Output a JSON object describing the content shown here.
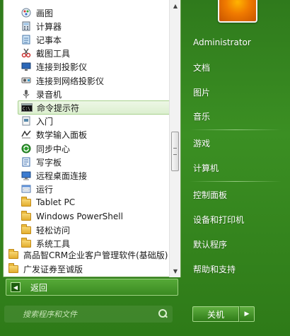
{
  "programs": {
    "sub_items": [
      {
        "label": "画图",
        "icon": "paint-icon"
      },
      {
        "label": "计算器",
        "icon": "calculator-icon"
      },
      {
        "label": "记事本",
        "icon": "notepad-icon"
      },
      {
        "label": "截图工具",
        "icon": "snipping-tool-icon"
      },
      {
        "label": "连接到投影仪",
        "icon": "projector-icon"
      },
      {
        "label": "连接到网络投影仪",
        "icon": "network-projector-icon"
      },
      {
        "label": "录音机",
        "icon": "microphone-icon"
      },
      {
        "label": "命令提示符",
        "icon": "command-prompt-icon"
      },
      {
        "label": "入门",
        "icon": "getting-started-icon"
      },
      {
        "label": "数学输入面板",
        "icon": "math-input-icon"
      },
      {
        "label": "同步中心",
        "icon": "sync-center-icon"
      },
      {
        "label": "写字板",
        "icon": "wordpad-icon"
      },
      {
        "label": "远程桌面连接",
        "icon": "remote-desktop-icon"
      },
      {
        "label": "运行",
        "icon": "run-icon"
      },
      {
        "label": "Tablet PC",
        "icon": "folder-icon"
      },
      {
        "label": "Windows PowerShell",
        "icon": "folder-icon"
      },
      {
        "label": "轻松访问",
        "icon": "folder-icon"
      },
      {
        "label": "系统工具",
        "icon": "folder-icon"
      }
    ],
    "top_items": [
      {
        "label": "高品智CRM企业客户管理软件(基础版)",
        "icon": "folder-icon"
      },
      {
        "label": "广发证券至诚版",
        "icon": "folder-icon"
      }
    ],
    "selected_index": 7
  },
  "back": {
    "label": "返回"
  },
  "search": {
    "placeholder": "搜索程序和文件"
  },
  "right": {
    "links": [
      {
        "label": "Administrator"
      },
      {
        "label": "文档"
      },
      {
        "label": "图片"
      },
      {
        "label": "音乐"
      },
      {
        "label": "游戏"
      },
      {
        "label": "计算机"
      },
      {
        "label": "控制面板"
      },
      {
        "label": "设备和打印机"
      },
      {
        "label": "默认程序"
      },
      {
        "label": "帮助和支持"
      }
    ]
  },
  "shutdown": {
    "label": "关机"
  },
  "colors": {
    "accent": "#3b8f23",
    "selection": "#dcefcf"
  }
}
